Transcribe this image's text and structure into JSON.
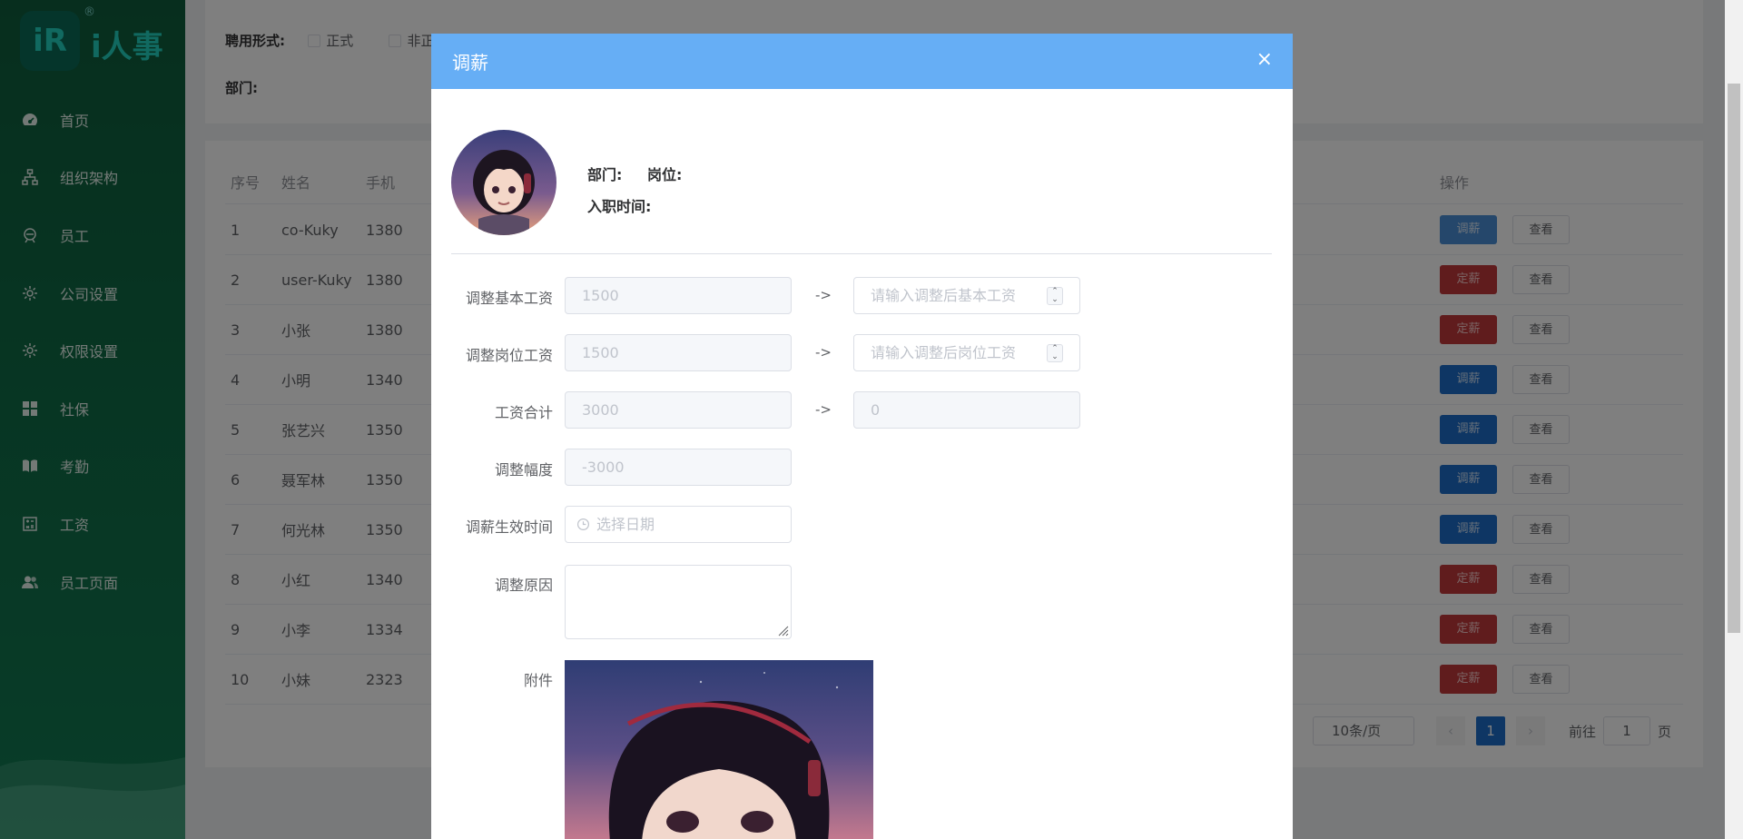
{
  "sidebar": {
    "logo_mark": "iR",
    "logo_text": "i人事",
    "logo_reg": "®",
    "items": [
      {
        "label": "首页",
        "icon": "dashboard-icon"
      },
      {
        "label": "组织架构",
        "icon": "org-chart-icon"
      },
      {
        "label": "员工",
        "icon": "employee-icon"
      },
      {
        "label": "公司设置",
        "icon": "gear-icon"
      },
      {
        "label": "权限设置",
        "icon": "gear-icon"
      },
      {
        "label": "社保",
        "icon": "grid-icon"
      },
      {
        "label": "考勤",
        "icon": "book-icon"
      },
      {
        "label": "工资",
        "icon": "calculator-icon"
      },
      {
        "label": "员工页面",
        "icon": "users-icon"
      }
    ]
  },
  "filter": {
    "employment_label": "聘用形式:",
    "opt_formal": "正式",
    "opt_informal": "非正",
    "dept_label": "部门:"
  },
  "table": {
    "headers": {
      "idx": "序号",
      "name": "姓名",
      "phone": "手机",
      "op": "操作"
    },
    "rows": [
      {
        "idx": "1",
        "name": "co-Kuky",
        "phone": "1380",
        "action": "调薪",
        "action_style": "blue-light",
        "view": "查看"
      },
      {
        "idx": "2",
        "name": "user-Kuky",
        "phone": "1380",
        "action": "定薪",
        "action_style": "red",
        "view": "查看"
      },
      {
        "idx": "3",
        "name": "小张",
        "phone": "1380",
        "action": "定薪",
        "action_style": "red",
        "view": "查看"
      },
      {
        "idx": "4",
        "name": "小明",
        "phone": "1340",
        "action": "调薪",
        "action_style": "blue",
        "view": "查看"
      },
      {
        "idx": "5",
        "name": "张艺兴",
        "phone": "1350",
        "action": "调薪",
        "action_style": "blue",
        "view": "查看"
      },
      {
        "idx": "6",
        "name": "聂军林",
        "phone": "1350",
        "action": "调薪",
        "action_style": "blue",
        "view": "查看"
      },
      {
        "idx": "7",
        "name": "何光林",
        "phone": "1350",
        "action": "调薪",
        "action_style": "blue",
        "view": "查看"
      },
      {
        "idx": "8",
        "name": "小红",
        "phone": "1340",
        "action": "定薪",
        "action_style": "red",
        "view": "查看"
      },
      {
        "idx": "9",
        "name": "小李",
        "phone": "1334",
        "action": "定薪",
        "action_style": "red",
        "view": "查看"
      },
      {
        "idx": "10",
        "name": "小妹",
        "phone": "2323",
        "action": "定薪",
        "action_style": "red",
        "view": "查看"
      }
    ]
  },
  "pager": {
    "page_size": "10条/页",
    "prev": "‹",
    "current": "1",
    "next": "›",
    "goto_prefix": "前往",
    "goto_value": "1",
    "goto_suffix": "页"
  },
  "dialog": {
    "title": "调薪",
    "close": "×",
    "dept_label": "部门:",
    "post_label": "岗位:",
    "hire_label": "入职时间:",
    "arrow": "->",
    "fields": {
      "base_label": "调整基本工资",
      "base_value": "1500",
      "base_new_placeholder": "请输入调整后基本工资",
      "post_label": "调整岗位工资",
      "post_value": "1500",
      "post_new_placeholder": "请输入调整后岗位工资",
      "total_label": "工资合计",
      "total_value": "3000",
      "total_new_value": "0",
      "range_label": "调整幅度",
      "range_value": "-3000",
      "date_label": "调薪生效时间",
      "date_placeholder": "选择日期",
      "reason_label": "调整原因",
      "attach_label": "附件"
    }
  },
  "colors": {
    "sidebar_bg": "#0f6b46",
    "dialog_header": "#66aef5",
    "primary": "#1d6dc8",
    "danger": "#c0393b"
  }
}
